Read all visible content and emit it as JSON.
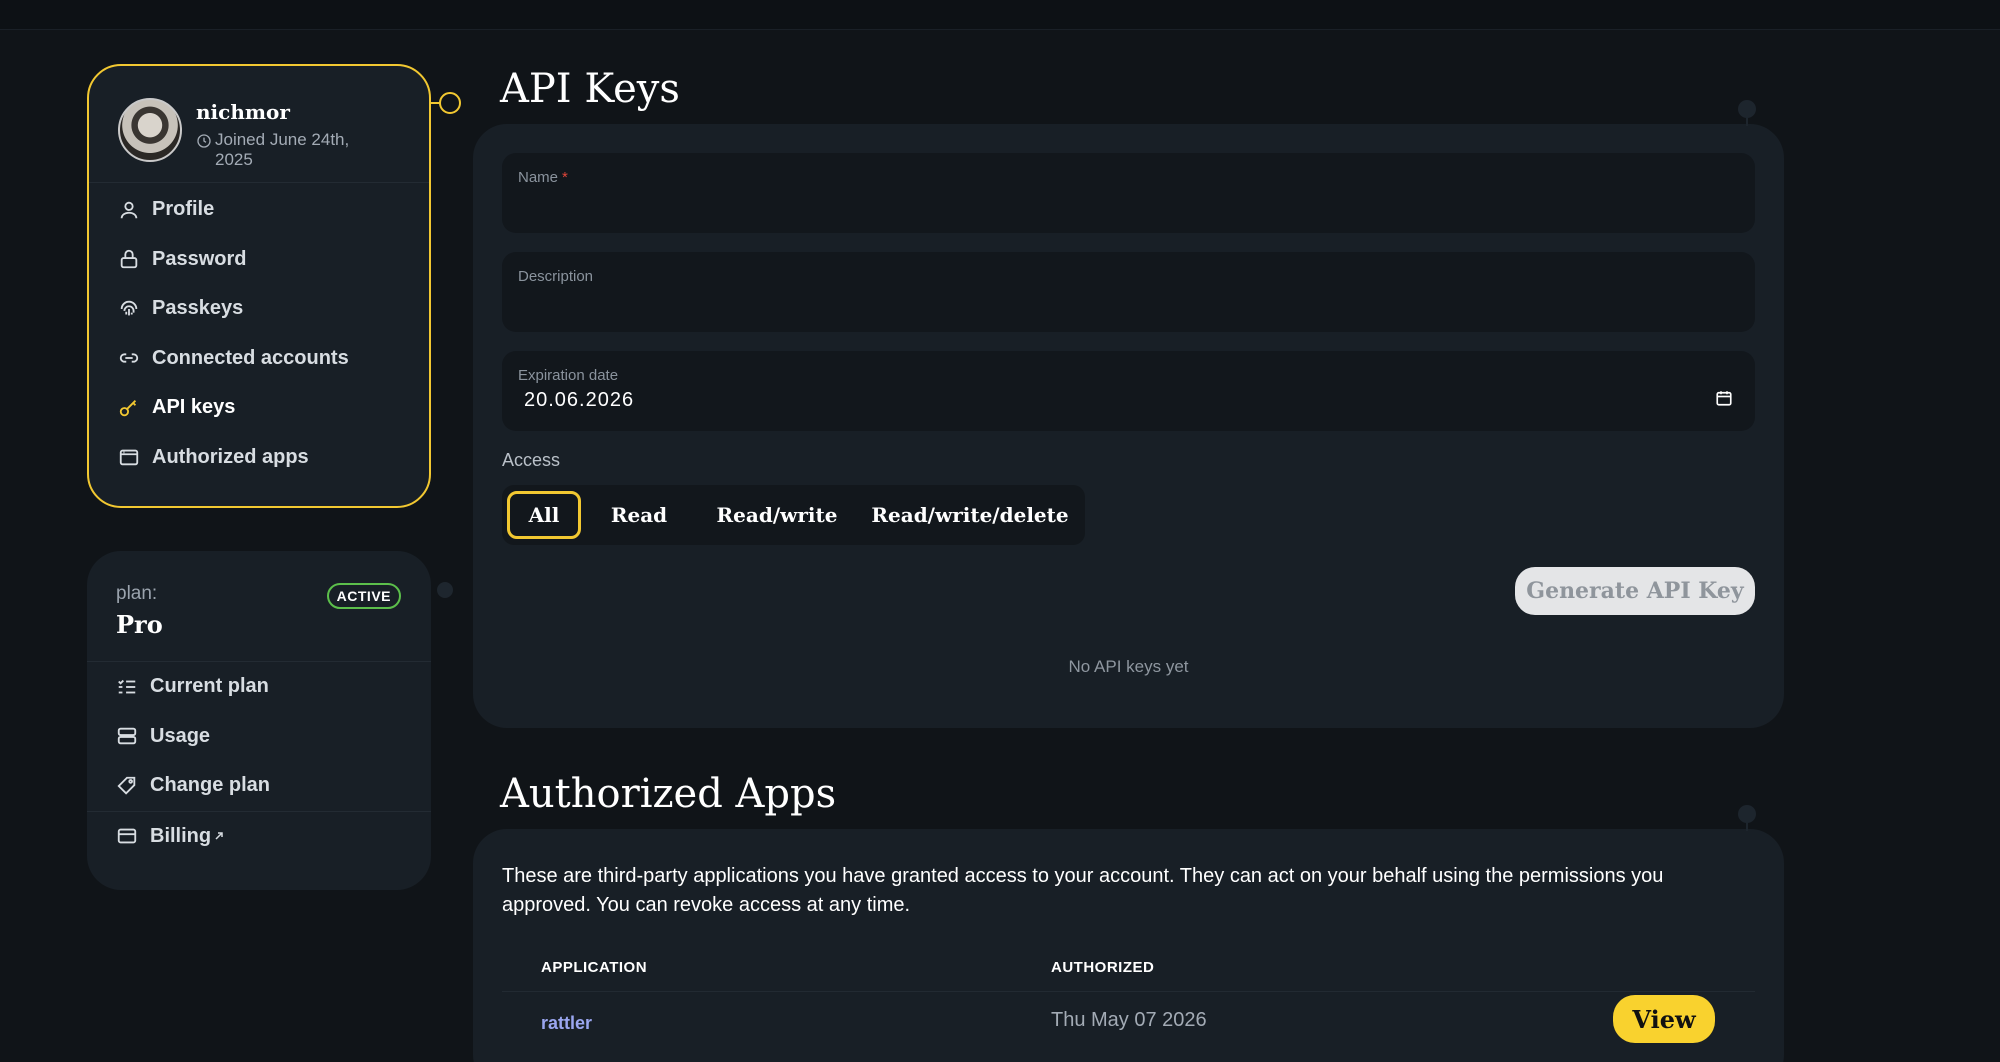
{
  "user": {
    "username": "nichmor",
    "joined": "Joined June 24th, 2025"
  },
  "account_nav": [
    {
      "label": "Profile",
      "icon": "user-icon"
    },
    {
      "label": "Password",
      "icon": "lock-icon"
    },
    {
      "label": "Passkeys",
      "icon": "fingerprint-icon"
    },
    {
      "label": "Connected accounts",
      "icon": "link-icon"
    },
    {
      "label": "API keys",
      "icon": "key-icon",
      "active": true
    },
    {
      "label": "Authorized apps",
      "icon": "window-icon"
    }
  ],
  "plan": {
    "label": "plan:",
    "name": "Pro",
    "badge": "ACTIVE"
  },
  "plan_nav": [
    {
      "label": "Current plan",
      "icon": "list-check-icon"
    },
    {
      "label": "Usage",
      "icon": "server-icon"
    },
    {
      "label": "Change plan",
      "icon": "tag-icon"
    },
    {
      "label": "Billing",
      "icon": "credit-card-icon",
      "external": true
    }
  ],
  "api_keys": {
    "title": "API Keys",
    "name_label": "Name",
    "required_mark": "*",
    "description_label": "Description",
    "expiration_label": "Expiration date",
    "expiration_value": "20.06.2026",
    "access_label": "Access",
    "access_options": [
      "All",
      "Read",
      "Read/write",
      "Read/write/delete"
    ],
    "access_selected": "All",
    "generate_label": "Generate API Key",
    "empty_text": "No API keys yet"
  },
  "authorized_apps": {
    "title": "Authorized Apps",
    "description": "These are third-party applications you have granted access to your account. They can act on your behalf using the permissions you approved. You can revoke access at any time.",
    "columns": [
      "APPLICATION",
      "AUTHORIZED"
    ],
    "rows": [
      {
        "application": "rattler",
        "authorized": "Thu May 07 2026",
        "action": "View"
      }
    ]
  },
  "colors": {
    "accent": "#f2c831",
    "active_badge": "#5cbf4b",
    "link": "#9aa6f0"
  }
}
